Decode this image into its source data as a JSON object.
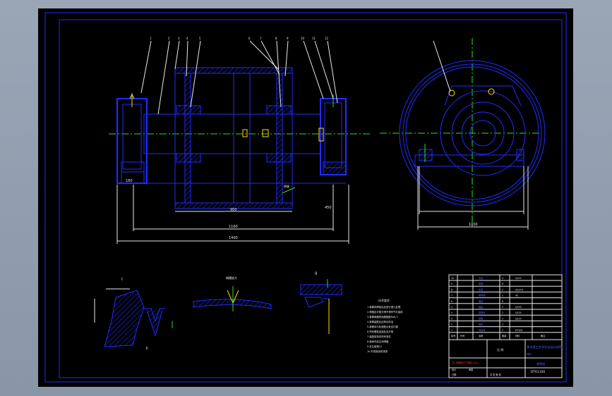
{
  "drawing": {
    "title_block": {
      "title_line": "青岛理工大学毕业设计说明",
      "material_label": "材料",
      "drawing_number": "DTK1100",
      "project_label": "卷筒组",
      "scale_label": "比 例",
      "notes_red": "注: 本图纸尺寸单位 mm",
      "designer_label": "设计",
      "checker_label": "审核",
      "date_label": "日期",
      "sheet_label": "共 张 第 张"
    },
    "parts_list_header": [
      "序号",
      "代号",
      "名称",
      "数量",
      "材料",
      "备注"
    ],
    "parts_rows": [
      [
        "1",
        "",
        "轴承座",
        "2",
        "HT200",
        ""
      ],
      [
        "2",
        "",
        "轴承",
        "2",
        "",
        ""
      ],
      [
        "3",
        "",
        "端盖",
        "2",
        "Q235",
        ""
      ],
      [
        "4",
        "",
        "卷筒体",
        "1",
        "Q235",
        ""
      ],
      [
        "5",
        "",
        "辐板",
        "2",
        "Q235",
        ""
      ],
      [
        "6",
        "",
        "螺栓",
        "8",
        "",
        ""
      ],
      [
        "7",
        "",
        "卷筒轴",
        "1",
        "45",
        ""
      ],
      [
        "8",
        "",
        "轮毂",
        "2",
        "ZG270",
        ""
      ],
      [
        "9",
        "",
        "垫圈",
        "8",
        "",
        ""
      ],
      [
        "10",
        "",
        "压板",
        "4",
        "Q235",
        ""
      ]
    ],
    "tech_requirements": {
      "title": "技术要求",
      "items": [
        "1.卷筒体焊接后应进行退火处理",
        "2.焊缝应平整光滑不得有气孔裂纹",
        "3.卷筒绳槽表面粗糙度Ra6.3",
        "4.卷筒装配后应转动灵活",
        "5.卷筒体与轮毂配合处应打磨",
        "6.所有螺栓连接处应拧紧",
        "7.装配前清洗所有零件",
        "8.轴承内加注润滑脂",
        "9.未注倒角C2",
        "10.外表面涂防锈漆"
      ]
    },
    "dimensions": {
      "overall_length": "1400",
      "inner_length": "1160",
      "drum_length": "900",
      "height": "450",
      "bearing_width": "180",
      "side_width": "1000"
    },
    "callouts": [
      "1",
      "2",
      "3",
      "4",
      "5",
      "6",
      "7",
      "8",
      "9",
      "10",
      "11",
      "12"
    ],
    "detail_labels": {
      "detail_1": "I",
      "detail_2": "绳槽放大",
      "detail_3": "II",
      "weld_symbol": "焊缝"
    }
  },
  "colors": {
    "outline": "#1f2dff",
    "dimension": "#e8e8e8",
    "centerline": "#24e524",
    "annotation": "#ffe000",
    "red_text": "#ff3030",
    "background": "#000000",
    "frame_bg": "#9aa6b6"
  }
}
